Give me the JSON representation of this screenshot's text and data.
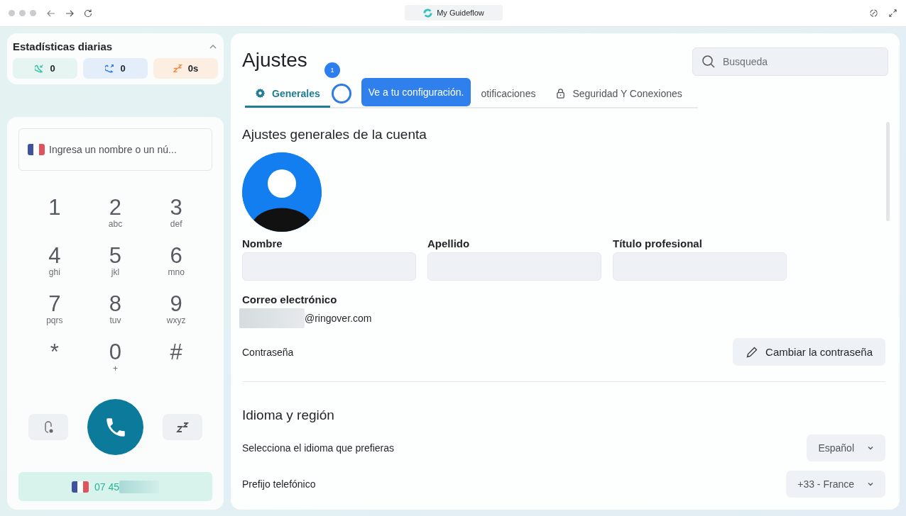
{
  "browser": {
    "tab_title": "My Guideflow"
  },
  "stats": {
    "title": "Estadísticas diarias",
    "expanded": true,
    "items": [
      {
        "kind": "incoming",
        "value": "0"
      },
      {
        "kind": "outgoing",
        "value": "0"
      },
      {
        "kind": "snooze",
        "value": "0s"
      }
    ]
  },
  "dialer": {
    "placeholder": "Ingresa un nombre o un nú...",
    "keys": [
      {
        "digit": "1"
      },
      {
        "digit": "2",
        "letters": "abc"
      },
      {
        "digit": "3",
        "letters": "def"
      },
      {
        "digit": "4",
        "letters": "ghi"
      },
      {
        "digit": "5",
        "letters": "jkl"
      },
      {
        "digit": "6",
        "letters": "mno"
      },
      {
        "digit": "7",
        "letters": "pqrs"
      },
      {
        "digit": "8",
        "letters": "tuv"
      },
      {
        "digit": "9",
        "letters": "wxyz"
      },
      {
        "digit": "*"
      },
      {
        "digit": "0",
        "letters": "+"
      },
      {
        "digit": "#"
      }
    ],
    "caller_id": "07 45"
  },
  "settings": {
    "title": "Ajustes",
    "search": {
      "placeholder": "Busqueda"
    },
    "tabs": [
      {
        "label": "Generales",
        "selected": true
      },
      {
        "label": "otificaciones",
        "selected": false
      },
      {
        "label": "Seguridad Y Conexiones",
        "selected": false
      }
    ],
    "guide": {
      "step": "1",
      "tooltip": "Ve a tu configuración."
    },
    "section_title": "Ajustes generales de la cuenta",
    "fields": [
      {
        "label": "Nombre"
      },
      {
        "label": "Apellido"
      },
      {
        "label": "Título profesional"
      }
    ],
    "email": {
      "label": "Correo electrónico",
      "value": "@ringover.com"
    },
    "password": {
      "label": "Contraseña",
      "button": "Cambiar la contraseña"
    },
    "region_title": "Idioma y región",
    "selects": [
      {
        "label": "Selecciona el idioma que prefieras",
        "value": "Español"
      },
      {
        "label": "Prefijo telefónico",
        "value": "+33 - France"
      }
    ]
  }
}
